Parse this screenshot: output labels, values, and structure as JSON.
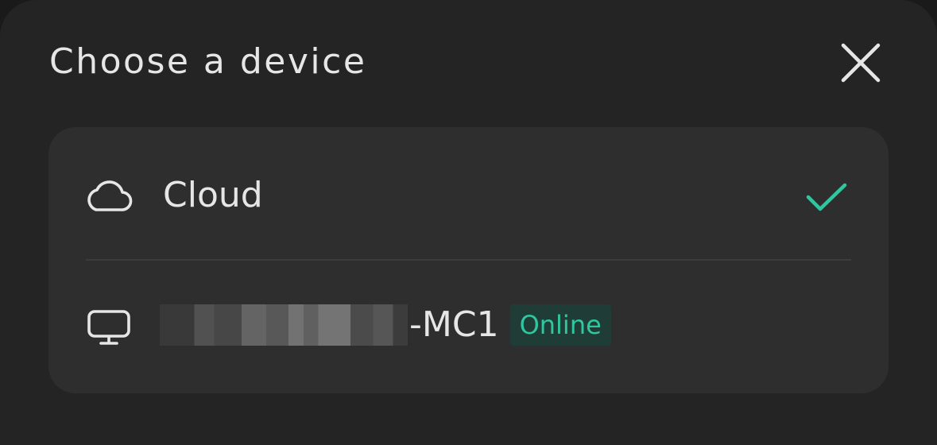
{
  "dialog": {
    "title": "Choose a device",
    "close_icon": "close-icon"
  },
  "devices": [
    {
      "name": "Cloud",
      "icon": "cloud-icon",
      "selected": true
    },
    {
      "name_suffix": "-MC1",
      "name_redacted": true,
      "icon": "monitor-icon",
      "status": "Online",
      "selected": false
    }
  ],
  "colors": {
    "sheet_background": "#242424",
    "card_background": "#2e2e2e",
    "text": "#e6e6e6",
    "accent_green": "#2fc6a0",
    "badge_background": "#1f3d36"
  }
}
